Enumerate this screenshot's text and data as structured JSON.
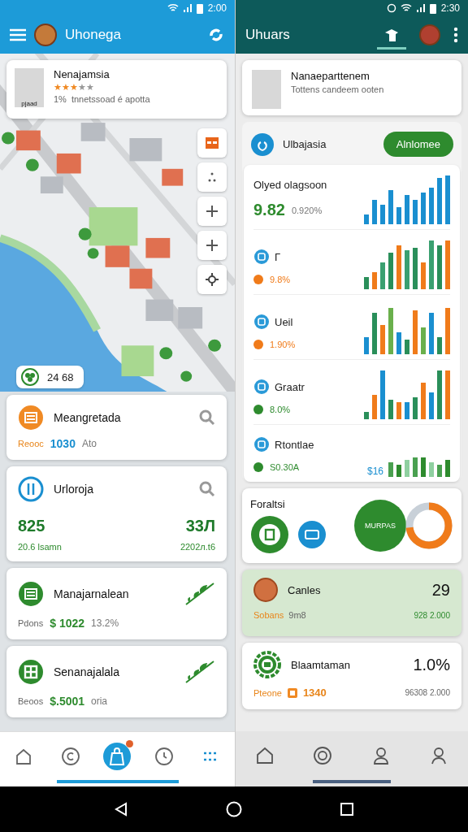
{
  "left": {
    "status_bar": {
      "time": "2:00"
    },
    "app_bar": {
      "title": "Uhonega"
    },
    "place_card": {
      "thumb_label": "pjaad",
      "title": "Nenajamsia",
      "stars": 3,
      "rating": "1%",
      "subtitle": "tnnetssoad é apotta"
    },
    "map_badge": {
      "text": "24 68"
    },
    "cards": [
      {
        "kind": "summary",
        "color": "#f08a24",
        "title": "Meangretada",
        "tag": "Reooc",
        "value": "1030",
        "extra": "Ato"
      },
      {
        "kind": "stats",
        "color": "#1a8fd0",
        "title": "Urloroja",
        "left_value": "825",
        "left_caption": "20.6 lsamn",
        "right_value": "33Л",
        "right_caption": "2202л.t6"
      },
      {
        "kind": "trend",
        "color": "#2e8b2e",
        "title": "Manajarnalean",
        "tag": "Pdons",
        "value": "$ 1022",
        "extra": "13.2%"
      },
      {
        "kind": "trend",
        "color": "#2e8b2e",
        "title": "Senanajalala",
        "tag": "Beoos",
        "value": "$.5001",
        "extra": "oria"
      }
    ],
    "nav": [
      {
        "selected": false
      },
      {
        "selected": false
      },
      {
        "selected": true
      },
      {
        "selected": false
      },
      {
        "selected": false
      }
    ]
  },
  "right": {
    "status_bar": {
      "time": "2:30"
    },
    "app_bar": {
      "title": "Uhuars"
    },
    "profile_card": {
      "title": "Nanaeparttenem",
      "subtitle": "Tottens candeem ooten"
    },
    "section": {
      "title": "Ulbajasia",
      "button": "Alnlomee"
    },
    "metrics": [
      {
        "title": "Olyed olagsoon",
        "value": "9.82",
        "change": "0.920%"
      },
      {
        "title": "Г",
        "change": "9.8%",
        "color": "#f07b1a"
      },
      {
        "title": "Ueil",
        "change": "1.90%",
        "color": "#f07b1a"
      },
      {
        "title": "Graatr",
        "change": "8.0%",
        "color": "#2e8b2e"
      },
      {
        "title": "Rtontlae",
        "change": "S0.30A",
        "tag": "$16",
        "color": "#2e8b2e"
      }
    ],
    "donut_card": {
      "title": "Foraltsi",
      "center_label": "MURPAS"
    },
    "person_card": {
      "title": "Canles",
      "value": "29",
      "tag": "Sobans",
      "sub": "9m8",
      "caption": "928 2.000"
    },
    "stat_card": {
      "title": "Blaamtaman",
      "value": "1.0%",
      "tag": "Pteone",
      "amount": "1340",
      "caption": "96308 2.000"
    }
  }
}
